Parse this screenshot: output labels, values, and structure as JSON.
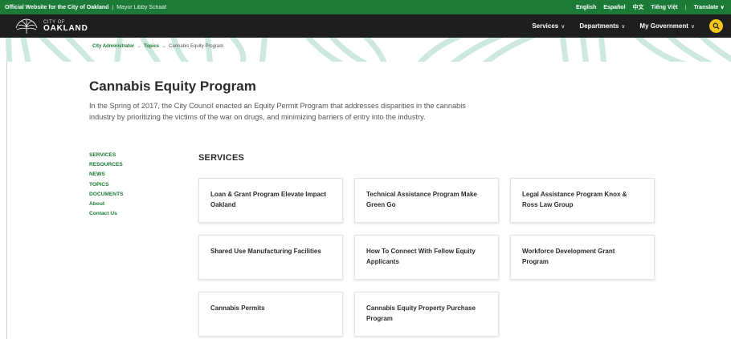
{
  "topbar": {
    "official": "Official Website for the City of Oakland",
    "separator": "|",
    "mayor": "Mayor Libby Schaaf",
    "languages": [
      "English",
      "Español",
      "中文",
      "Tiếng Việt"
    ],
    "pipe": "|",
    "translate": "Translate",
    "translate_chevron": "∨"
  },
  "logo": {
    "city_of": "CITY OF",
    "oakland": "OAKLAND"
  },
  "nav": {
    "items": [
      {
        "label": "Services",
        "chevron": "∨"
      },
      {
        "label": "Departments",
        "chevron": "∨"
      },
      {
        "label": "My Government",
        "chevron": "∨"
      }
    ],
    "search_icon": "search-icon"
  },
  "breadcrumb": {
    "items": [
      "City Administrator",
      "Topics"
    ],
    "arrow": "→",
    "current": "Cannabis Equity Program"
  },
  "page": {
    "title": "Cannabis Equity Program",
    "intro": "In the Spring of 2017, the City Council enacted an Equity Permit Program that addresses disparities in the cannabis industry by prioritizing the victims of the war on drugs, and minimizing barriers of entry into the industry."
  },
  "sidenav": [
    "SERVICES",
    "RESOURCES",
    "NEWS",
    "TOPICS",
    "DOCUMENTS",
    "About",
    "Contact Us"
  ],
  "services": {
    "heading": "SERVICES",
    "cards": [
      "Loan & Grant Program Elevate Impact Oakland",
      "Technical Assistance Program Make Green Go",
      "Legal Assistance Program Knox & Ross Law Group",
      "Shared Use Manufacturing Facilities",
      "How To Connect With Fellow Equity Applicants",
      "Workforce Development Grant Program",
      "Cannabis Permits",
      "Cannabis Equity Property Purchase Program"
    ]
  },
  "colors": {
    "brand_green": "#1b7a35",
    "nav_dark": "#1e1e1e",
    "search_yellow": "#f5c518",
    "banner_pattern": "#cde8dd"
  }
}
